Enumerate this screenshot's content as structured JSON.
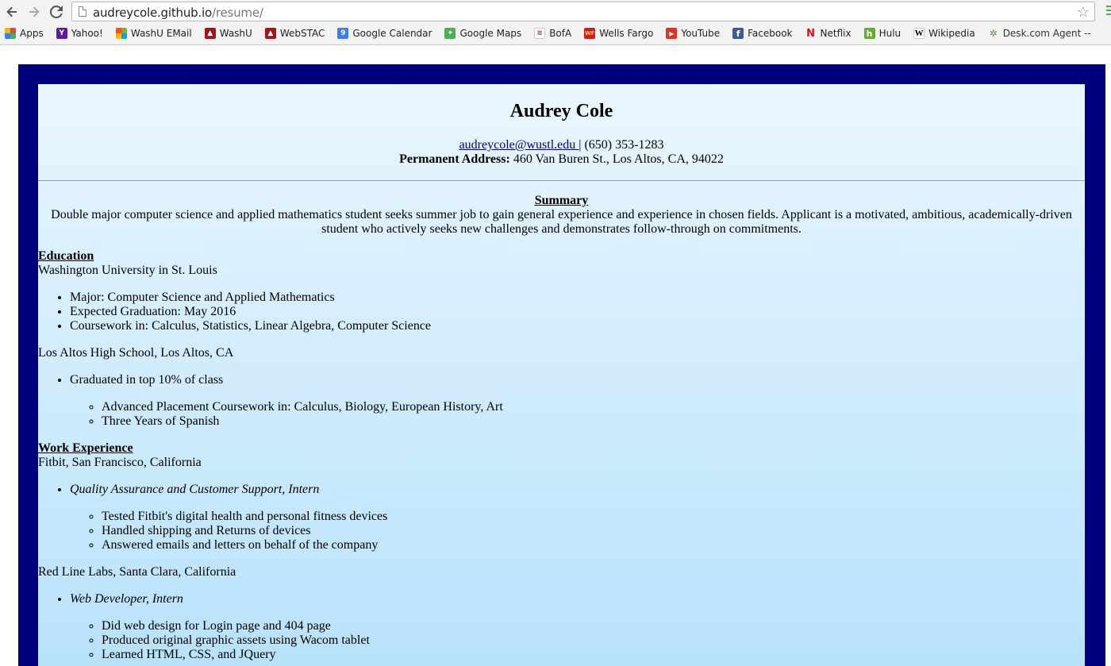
{
  "browser": {
    "url_host": "audreycole.github.io",
    "url_path": "/resume/",
    "bookmarks": [
      {
        "label": "Apps",
        "icon": "apps-grid-icon",
        "color": "#e0493b"
      },
      {
        "label": "Yahoo!",
        "icon": "yahoo-icon",
        "color": "#5c1a9e"
      },
      {
        "label": "WashU EMail",
        "icon": "windows-icon",
        "color": "#f25022"
      },
      {
        "label": "WashU",
        "icon": "washu-shield-icon",
        "color": "#a51417"
      },
      {
        "label": "WebSTAC",
        "icon": "washu-shield-icon",
        "color": "#a51417"
      },
      {
        "label": "Google Calendar",
        "icon": "calendar-icon",
        "color": "#3d7de6"
      },
      {
        "label": "Google Maps",
        "icon": "maps-icon",
        "color": "#4caf50"
      },
      {
        "label": "BofA",
        "icon": "bofa-icon",
        "color": "#d22030"
      },
      {
        "label": "Wells Fargo",
        "icon": "wells-fargo-icon",
        "color": "#cc1e1e"
      },
      {
        "label": "YouTube",
        "icon": "youtube-icon",
        "color": "#e52d27"
      },
      {
        "label": "Facebook",
        "icon": "facebook-icon",
        "color": "#3b5998"
      },
      {
        "label": "Netflix",
        "icon": "netflix-icon",
        "color": "#e50914"
      },
      {
        "label": "Hulu",
        "icon": "hulu-icon",
        "color": "#66aa33"
      },
      {
        "label": "Wikipedia",
        "icon": "wikipedia-icon",
        "color": "#ffffff"
      },
      {
        "label": "Desk.com Agent -- ",
        "icon": "desk-icon",
        "color": "#5a8f5a"
      }
    ]
  },
  "resume": {
    "name": "Audrey Cole",
    "email": "audreycole@wustl.edu ",
    "separator": "|",
    "phone": "(650) 353-1283",
    "address_label": "Permanent Address:",
    "address": "460 Van Buren St., Los Altos, CA, 94022",
    "summary_title": "Summary",
    "summary_text": "Double major computer science and applied mathematics student seeks summer job to gain general experience and experience in chosen fields. Applicant is a motivated, ambitious, academically-driven student who actively seeks new challenges and demonstrates follow-through on commitments.",
    "education_title": "Education",
    "education": [
      {
        "school": "Washington University in St. Louis",
        "items": [
          "Major: Computer Science and Applied Mathematics",
          "Expected Graduation: May 2016",
          "Coursework in: Calculus, Statistics, Linear Algebra, Computer Science"
        ]
      },
      {
        "school": "Los Altos High School, Los Altos, CA",
        "item": "Graduated in top 10% of class",
        "subitems": [
          "Advanced Placement Coursework in: Calculus, Biology, European History, Art",
          "Three Years of Spanish"
        ]
      }
    ],
    "work_title": "Work Experience",
    "work": [
      {
        "company": "Fitbit, San Francisco, California",
        "role": "Quality Assurance and Customer Support, Intern",
        "duties": [
          "Tested Fitbit's digital health and personal fitness devices",
          "Handled shipping and Returns of devices",
          "Answered emails and letters on behalf of the company"
        ]
      },
      {
        "company": "Red Line Labs, Santa Clara, California",
        "role": "Web Developer, Intern",
        "duties": [
          "Did web design for Login page and 404 page",
          "Produced original graphic assets using Wacom tablet",
          "Learned HTML, CSS, and JQuery"
        ]
      }
    ]
  }
}
